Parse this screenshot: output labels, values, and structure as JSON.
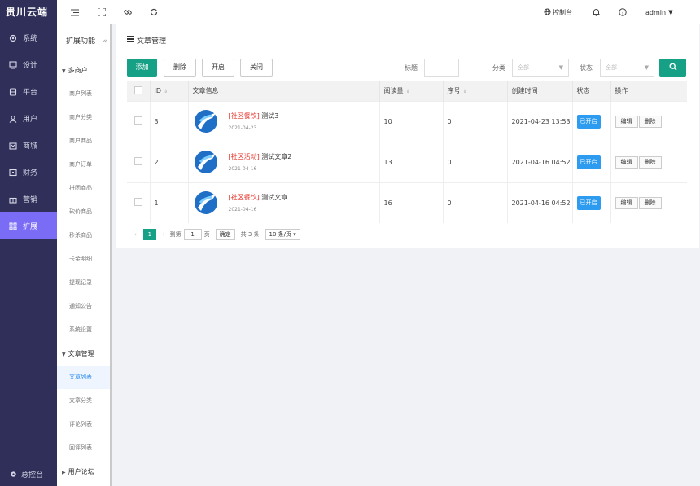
{
  "app": {
    "brand": "贵川云端"
  },
  "nav": {
    "items": [
      {
        "label": "系统",
        "icon": "gear-icon"
      },
      {
        "label": "设计",
        "icon": "monitor-icon"
      },
      {
        "label": "平台",
        "icon": "database-icon"
      },
      {
        "label": "用户",
        "icon": "user-icon"
      },
      {
        "label": "商城",
        "icon": "shop-icon"
      },
      {
        "label": "财务",
        "icon": "wallet-icon"
      },
      {
        "label": "营销",
        "icon": "gift-icon"
      },
      {
        "label": "扩展",
        "icon": "grid-icon"
      }
    ],
    "bottom": "总控台"
  },
  "subnav": {
    "title": "扩展功能",
    "collapse": "«",
    "groups": [
      {
        "label": "多商户",
        "items": [
          "商户列表",
          "商户分类",
          "商户商品",
          "商户订单",
          "拼团商品",
          "砍价商品",
          "秒杀商品",
          "卡金明细",
          "提现记录",
          "通知公告",
          "系统设置"
        ]
      },
      {
        "label": "文章管理",
        "items": [
          "文章列表",
          "文章分类",
          "评论列表",
          "回评列表"
        ]
      },
      {
        "label": "用户论坛",
        "items": []
      }
    ]
  },
  "topbar": {
    "console": "控制台",
    "user": "admin"
  },
  "page": {
    "title": "文章管理",
    "buttons": {
      "add": "添加",
      "delete": "删除",
      "open": "开启",
      "close": "关闭"
    },
    "filters": {
      "title_label": "标题",
      "category_label": "分类",
      "category_value": "全部",
      "status_label": "状态",
      "status_value": "全部"
    },
    "columns": [
      "ID",
      "文章信息",
      "阅读量",
      "序号",
      "创建时间",
      "状态",
      "操作"
    ],
    "rows": [
      {
        "id": "3",
        "category": "[社区餐饮]",
        "title": "测试3",
        "date": "2021-04-23",
        "views": "10",
        "order": "0",
        "created": "2021-04-23 13:53",
        "status": "已开启",
        "edit": "编辑",
        "del": "删除"
      },
      {
        "id": "2",
        "category": "[社区活动]",
        "title": "测试文章2",
        "date": "2021-04-16",
        "views": "13",
        "order": "0",
        "created": "2021-04-16 04:52",
        "status": "已开启",
        "edit": "编辑",
        "del": "删除"
      },
      {
        "id": "1",
        "category": "[社区餐饮]",
        "title": "测试文章",
        "date": "2021-04-16",
        "views": "16",
        "order": "0",
        "created": "2021-04-16 04:52",
        "status": "已开启",
        "edit": "编辑",
        "del": "删除"
      }
    ],
    "pager": {
      "current": "1",
      "goto_label": "到第",
      "goto_value": "1",
      "page_unit": "页",
      "confirm": "确定",
      "total": "共 3 条",
      "page_size": "10 条/页"
    }
  },
  "colors": {
    "sidebar": "#2f2f5a",
    "active": "#7b6cf6",
    "primary": "#16a085",
    "status": "#2d9bf0",
    "category": "#e6342a"
  }
}
